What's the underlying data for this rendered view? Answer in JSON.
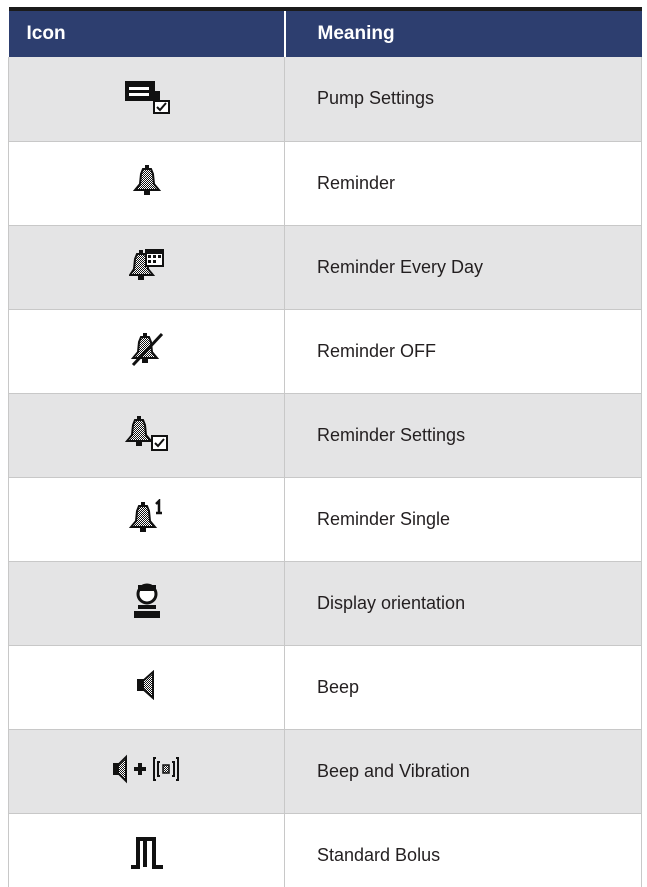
{
  "table": {
    "headers": {
      "icon": "Icon",
      "meaning": "Meaning"
    },
    "header_color": "#2d3e6f",
    "row_colors": [
      "#e4e4e5",
      "#ffffff"
    ],
    "rows": [
      {
        "icon": "pump-settings-icon",
        "meaning": "Pump Settings"
      },
      {
        "icon": "reminder-bell-icon",
        "meaning": "Reminder"
      },
      {
        "icon": "reminder-every-day-icon",
        "meaning": "Reminder Every Day"
      },
      {
        "icon": "reminder-off-icon",
        "meaning": "Reminder OFF"
      },
      {
        "icon": "reminder-settings-icon",
        "meaning": "Reminder Settings"
      },
      {
        "icon": "reminder-single-icon",
        "meaning": "Reminder Single"
      },
      {
        "icon": "display-orientation-icon",
        "meaning": "Display orientation"
      },
      {
        "icon": "beep-speaker-icon",
        "meaning": "Beep"
      },
      {
        "icon": "beep-and-vibration-icon",
        "meaning": "Beep and Vibration"
      },
      {
        "icon": "standard-bolus-icon",
        "meaning": "Standard Bolus"
      }
    ]
  }
}
